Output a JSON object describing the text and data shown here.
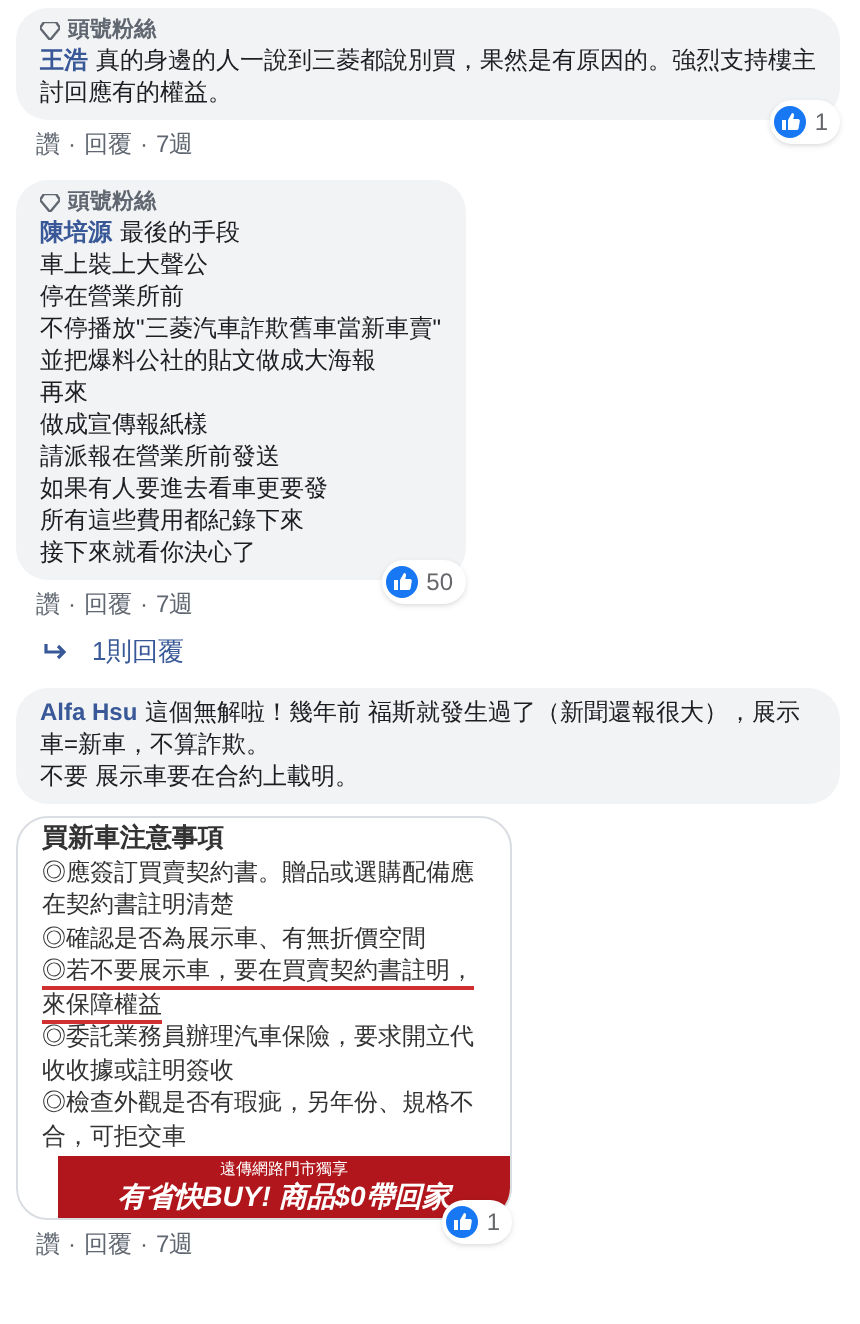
{
  "comments": [
    {
      "badge": "頭號粉絲",
      "author": "王浩",
      "lines": [
        "真的身邊的人一說到三菱都說別買，果然是有原因的。強烈支持樓主討回應有的權益。"
      ],
      "separator": "·",
      "actions": [
        "讚",
        "回覆",
        "7週"
      ],
      "likes": "1"
    },
    {
      "badge": "頭號粉絲",
      "author": "陳培源",
      "lines": [
        "最後的手段",
        "車上裝上大聲公",
        "停在營業所前",
        "不停播放\"三菱汽車詐欺舊車當新車賣\"",
        "並把爆料公社的貼文做成大海報",
        "再來",
        "做成宣傳報紙樣",
        "請派報在營業所前發送",
        "如果有人要進去看車更要發",
        "所有這些費用都紀錄下來",
        "接下來就看你決心了"
      ],
      "separator": "·",
      "actions": [
        "讚",
        "回覆",
        "7週"
      ],
      "likes": "50",
      "replies": "1則回覆"
    },
    {
      "author": "Alfa Hsu",
      "lines": [
        "這個無解啦！幾年前 福斯就發生過了（新聞還報很大），展示車=新車，不算詐欺。",
        "不要 展示車要在合約上載明。"
      ],
      "separator": "·",
      "attachment": {
        "title": "買新車注意事項",
        "items": [
          {
            "text": "◎應簽訂買賣契約書。贈品或選購配備應在契約書註明清楚",
            "underlined": false
          },
          {
            "text": "◎確認是否為展示車、有無折價空間",
            "underlined": false
          },
          {
            "text": "◎若不要展示車，要在買賣契約書註明，來保障權益",
            "underlined": true
          },
          {
            "text": "◎委託業務員辦理汽車保險，要求開立代收收據或註明簽收",
            "underlined": false
          },
          {
            "text": "◎檢查外觀是否有瑕疵，另年份、規格不合，可拒交車",
            "underlined": false
          }
        ],
        "banner": {
          "top": "遠傳網路門市獨享",
          "main": "有省快BUY! 商品$0帶回家"
        }
      },
      "actions": [
        "讚",
        "回覆",
        "7週"
      ],
      "likes": "1"
    }
  ]
}
